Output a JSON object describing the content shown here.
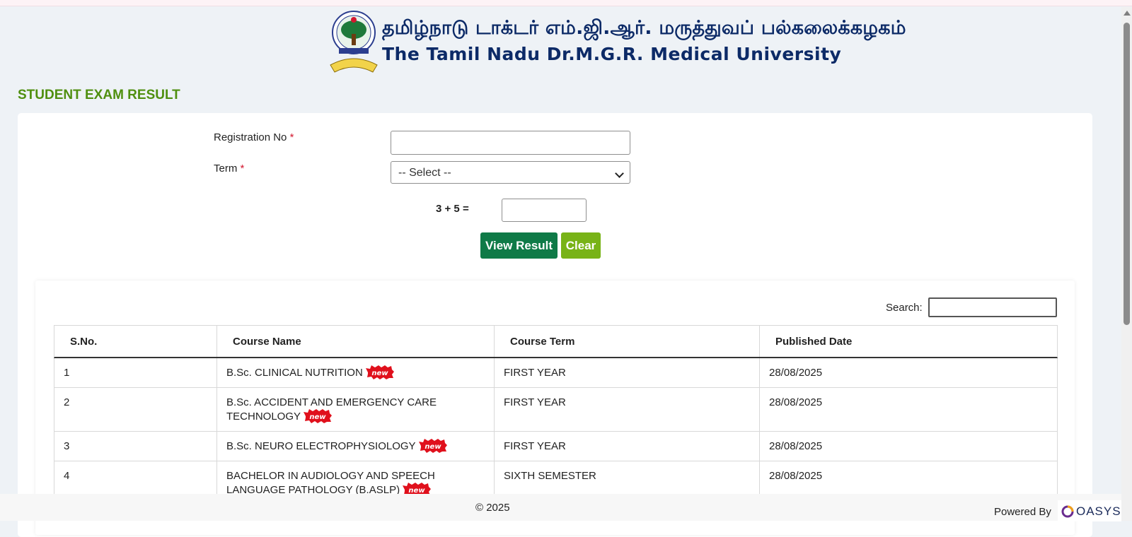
{
  "header": {
    "title_tamil": "தமிழ்நாடு டாக்டர் எம்.ஜி.ஆர். மருத்துவப் பல்கலைக்கழகம்",
    "title_english": "The Tamil Nadu Dr.M.G.R. Medical University"
  },
  "page": {
    "heading": "STUDENT EXAM RESULT"
  },
  "form": {
    "registration_label": "Registration No",
    "registration_value": "",
    "term_label": "Term",
    "required_mark": "*",
    "term_selected": "-- Select --",
    "captcha_question": "3 + 5 =",
    "captcha_value": "",
    "view_button": "View Result",
    "clear_button": "Clear"
  },
  "table": {
    "search_label": "Search:",
    "search_value": "",
    "badge_text": "new",
    "columns": [
      "S.No.",
      "Course Name",
      "Course Term",
      "Published Date"
    ],
    "rows": [
      {
        "sno": "1",
        "course_line1": "B.Sc. CLINICAL NUTRITION",
        "course_line2": "",
        "term": "FIRST YEAR",
        "date": "28/08/2025"
      },
      {
        "sno": "2",
        "course_line1": "B.Sc. ACCIDENT AND EMERGENCY CARE",
        "course_line2": "TECHNOLOGY",
        "term": "FIRST YEAR",
        "date": "28/08/2025"
      },
      {
        "sno": "3",
        "course_line1": "B.Sc. NEURO ELECTROPHYSIOLOGY",
        "course_line2": "",
        "term": "FIRST YEAR",
        "date": "28/08/2025"
      },
      {
        "sno": "4",
        "course_line1": "BACHELOR IN AUDIOLOGY AND SPEECH",
        "course_line2": "LANGUAGE PATHOLOGY (B.ASLP)",
        "term": "SIXTH SEMESTER",
        "date": "28/08/2025"
      }
    ]
  },
  "footer": {
    "copyright": "© 2025",
    "powered_by": "Powered By",
    "brand": "OASYS"
  },
  "colors": {
    "heading_green": "#4f8f0f",
    "view_button_bg": "#0f7a47",
    "clear_button_bg": "#78b317",
    "badge_red": "#e0101c",
    "title_navy": "#0c2a67"
  }
}
